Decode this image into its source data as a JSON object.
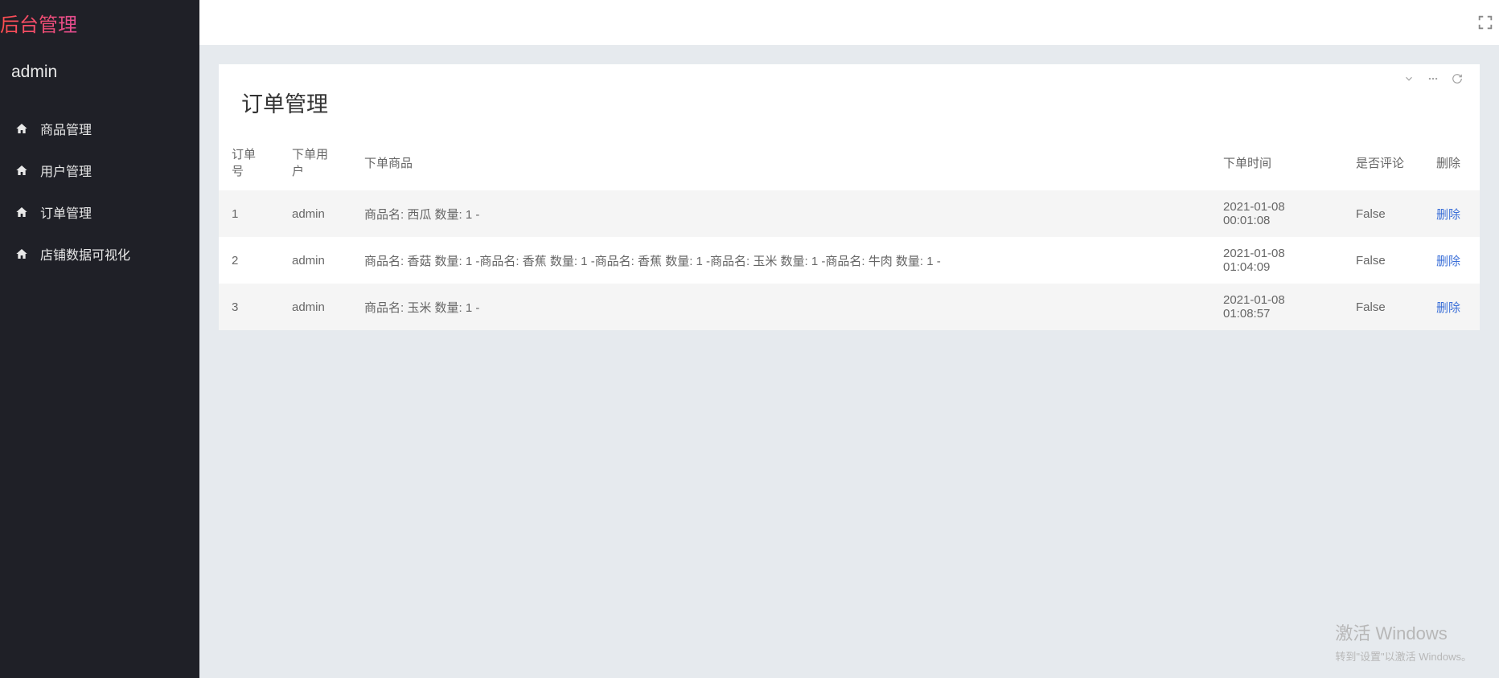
{
  "sidebar": {
    "title": "后台管理",
    "user": "admin",
    "items": [
      {
        "label": "商品管理"
      },
      {
        "label": "用户管理"
      },
      {
        "label": "订单管理"
      },
      {
        "label": "店铺数据可视化"
      }
    ]
  },
  "page": {
    "title": "订单管理"
  },
  "table": {
    "headers": {
      "id": "订单号",
      "user": "下单用户",
      "items": "下单商品",
      "time": "下单时间",
      "reviewed": "是否评论",
      "delete": "删除"
    },
    "rows": [
      {
        "id": "1",
        "user": "admin",
        "items": "商品名: 西瓜 数量: 1 -",
        "time": "2021-01-08 00:01:08",
        "reviewed": "False",
        "delete": "删除"
      },
      {
        "id": "2",
        "user": "admin",
        "items": "商品名: 香菇 数量: 1 -商品名: 香蕉 数量: 1 -商品名: 香蕉 数量: 1 -商品名: 玉米 数量: 1 -商品名: 牛肉 数量: 1 -",
        "time": "2021-01-08 01:04:09",
        "reviewed": "False",
        "delete": "删除"
      },
      {
        "id": "3",
        "user": "admin",
        "items": "商品名: 玉米 数量: 1 -",
        "time": "2021-01-08 01:08:57",
        "reviewed": "False",
        "delete": "删除"
      }
    ]
  },
  "watermark": {
    "line1": "激活 Windows",
    "line2": "转到\"设置\"以激活 Windows。"
  }
}
